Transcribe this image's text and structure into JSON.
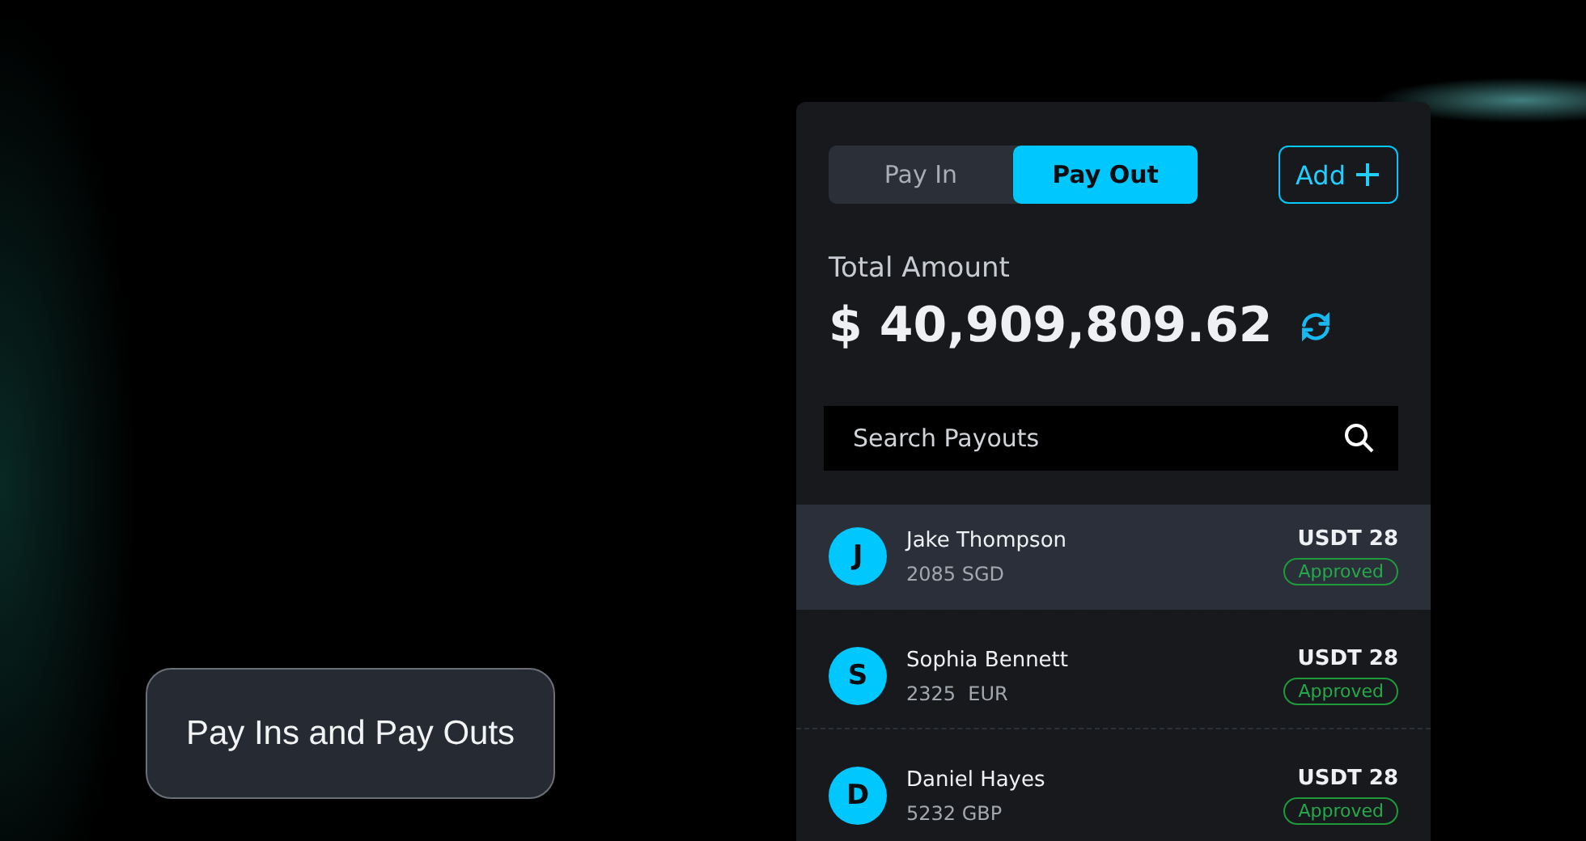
{
  "caption": "Pay Ins and Pay Outs",
  "panel": {
    "tabs": [
      {
        "label": "Pay In",
        "selected": false
      },
      {
        "label": "Pay Out",
        "selected": true
      }
    ],
    "add_button": "Add",
    "total_label": "Total Amount",
    "total_amount": "$ 40,909,809.62",
    "search": {
      "placeholder": "Search Payouts"
    },
    "payouts": [
      {
        "initial": "J",
        "name": "Jake Thompson",
        "amount": "2085 SGD",
        "usdt": "USDT 28",
        "status": "Approved",
        "selected": true
      },
      {
        "initial": "S",
        "name": "Sophia Bennett",
        "amount": "2325  EUR",
        "usdt": "USDT 28",
        "status": "Approved",
        "selected": false
      },
      {
        "initial": "D",
        "name": "Daniel Hayes",
        "amount": "5232 GBP",
        "usdt": "USDT 28",
        "status": "Approved",
        "selected": false
      }
    ]
  }
}
